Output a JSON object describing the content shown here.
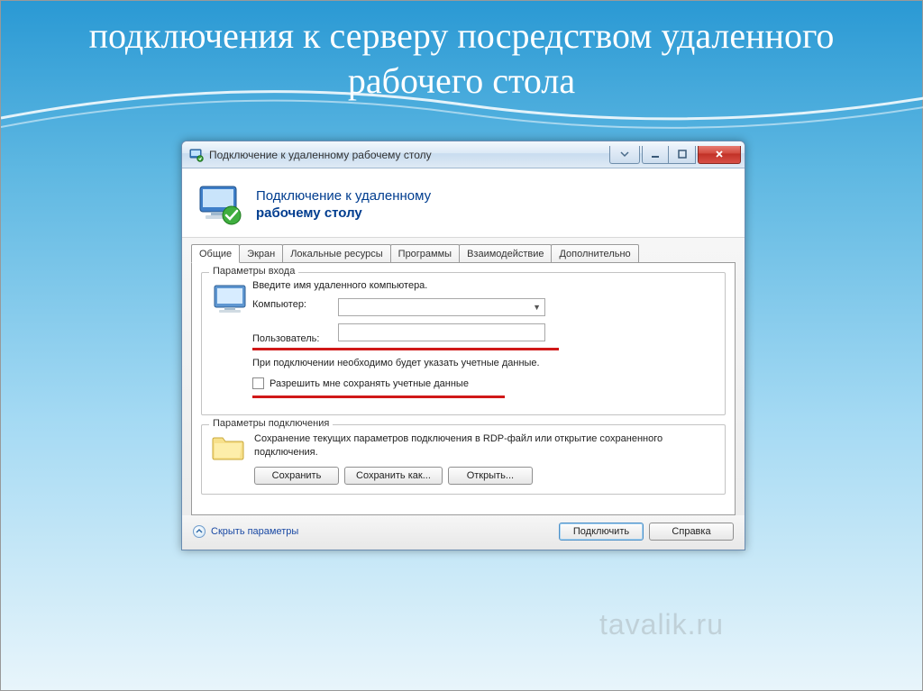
{
  "slide": {
    "title": "подключения к серверу посредством удаленного рабочего стола"
  },
  "window": {
    "title": "Подключение к удаленному рабочему столу",
    "header_line1": "Подключение к удаленному",
    "header_line2": "рабочему столу"
  },
  "tabs": [
    "Общие",
    "Экран",
    "Локальные ресурсы",
    "Программы",
    "Взаимодействие",
    "Дополнительно"
  ],
  "login": {
    "legend": "Параметры входа",
    "intro": "Введите имя удаленного компьютера.",
    "computer_label": "Компьютер:",
    "computer_value": "",
    "user_label": "Пользователь:",
    "user_value": "",
    "hint": "При подключении необходимо будет указать учетные данные.",
    "remember_label": "Разрешить мне сохранять учетные данные"
  },
  "conn": {
    "legend": "Параметры подключения",
    "text": "Сохранение текущих параметров подключения в RDP-файл или открытие сохраненного подключения.",
    "btn_save": "Сохранить",
    "btn_save_as": "Сохранить как...",
    "btn_open": "Открыть..."
  },
  "footer": {
    "hide_params": "Скрыть параметры",
    "connect": "Подключить",
    "help": "Справка"
  },
  "watermark": "tavalik.ru"
}
